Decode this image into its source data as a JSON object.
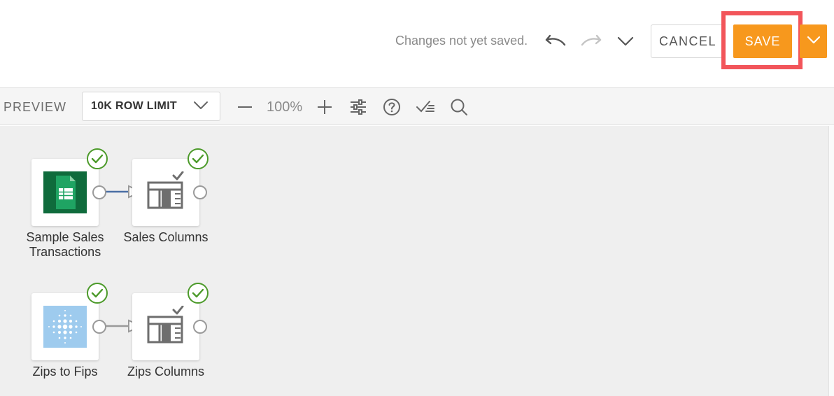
{
  "header": {
    "status_text": "Changes not yet saved.",
    "undo_icon": "undo-icon",
    "redo_icon": "redo-icon",
    "more_icon": "chevron-down-icon",
    "cancel_label": "CANCEL",
    "save_label": "SAVE",
    "save_menu_icon": "chevron-down-icon"
  },
  "toolbar": {
    "preview_label": "PREVIEW",
    "row_limit": "10K ROW LIMIT",
    "zoom_level": "100%",
    "icons": [
      "minus-icon",
      "plus-icon",
      "sliders-icon",
      "help-icon",
      "checklist-icon",
      "search-icon"
    ]
  },
  "canvas": {
    "nodes": [
      {
        "label": "Sample Sales Transactions",
        "icon": "google-sheets-icon",
        "status": "ok"
      },
      {
        "label": "Sales Columns",
        "icon": "select-columns-icon",
        "status": "ok"
      },
      {
        "label": "Zips to Fips",
        "icon": "dataset-icon",
        "status": "ok"
      },
      {
        "label": "Zips Columns",
        "icon": "select-columns-icon",
        "status": "ok"
      }
    ]
  },
  "colors": {
    "save": "#f7981d",
    "highlight": "#f2555a",
    "check": "#4c9a2a",
    "sheets": "#1e7e45",
    "connector_active": "#4a6fa5",
    "connector_idle": "#9a9a9a"
  }
}
